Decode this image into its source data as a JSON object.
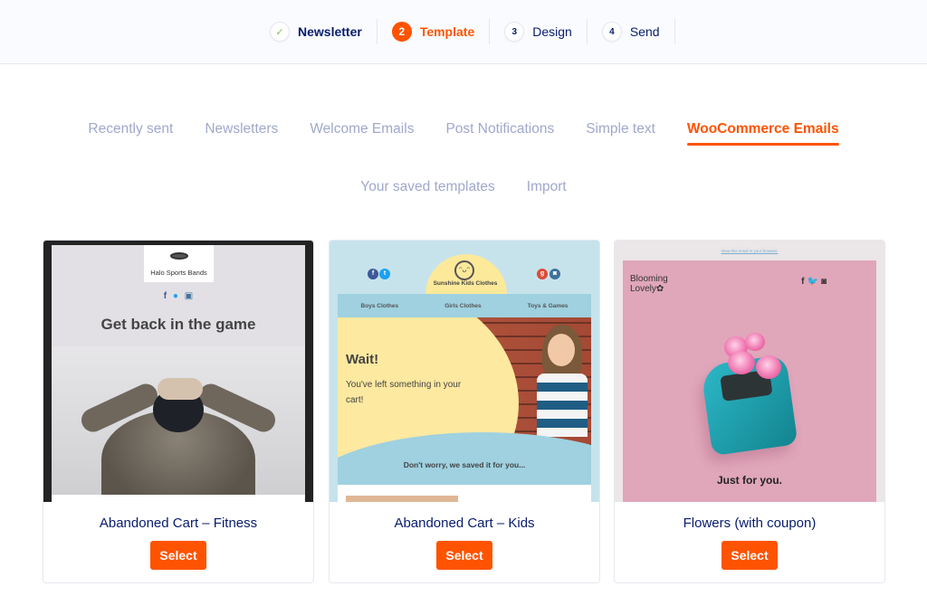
{
  "wizard": {
    "steps": [
      {
        "number": "✓",
        "label": "Newsletter",
        "state": "done"
      },
      {
        "number": "2",
        "label": "Template",
        "state": "active"
      },
      {
        "number": "3",
        "label": "Design",
        "state": "upcoming"
      },
      {
        "number": "4",
        "label": "Send",
        "state": "upcoming"
      }
    ]
  },
  "tabs": {
    "row1": [
      "Recently sent",
      "Newsletters",
      "Welcome Emails",
      "Post Notifications",
      "Simple text",
      "WooCommerce Emails"
    ],
    "row2": [
      "Your saved templates",
      "Import"
    ],
    "active": "WooCommerce Emails"
  },
  "colors": {
    "accent": "#fe5301",
    "navy": "#071c6d",
    "tab_inactive": "#a0a8cc"
  },
  "templates": [
    {
      "title": "Abandoned Cart – Fitness",
      "select_label": "Select",
      "preview": {
        "brand": "Halo Sports Bands",
        "headline": "Get back in the game",
        "social": [
          "f",
          "t",
          "ig"
        ]
      }
    },
    {
      "title": "Abandoned Cart – Kids",
      "select_label": "Select",
      "preview": {
        "brand": "Sunshine Kids Clothes",
        "nav": [
          "Boys Clothes",
          "Girls Clothes",
          "Toys & Games"
        ],
        "headline": "Wait!",
        "message": "You've left something in your cart!",
        "footer": "Don't worry, we saved it for you..."
      }
    },
    {
      "title": "Flowers (with coupon)",
      "select_label": "Select",
      "preview": {
        "view_link": "View this email in your browser.",
        "brand_line1": "Blooming",
        "brand_line2": "Lovely",
        "social": "f 🐦 ◙",
        "tagline": "Just for you."
      }
    }
  ]
}
